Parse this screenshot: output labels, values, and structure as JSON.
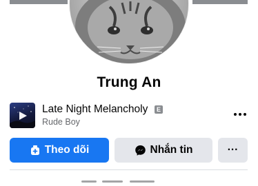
{
  "profile": {
    "name": "Trung An",
    "avatar_icon": "cat-avatar"
  },
  "music": {
    "song_title": "Late Night Melancholy",
    "explicit_badge": "E",
    "artist": "Rude Boy",
    "art_icon": "album-art-night-sky"
  },
  "actions": {
    "follow_label": "Theo dõi",
    "message_label": "Nhắn tin",
    "more_label": "···"
  },
  "colors": {
    "primary": "#1877f2",
    "secondary_button": "#e4e6eb",
    "muted_text": "#65676b"
  }
}
